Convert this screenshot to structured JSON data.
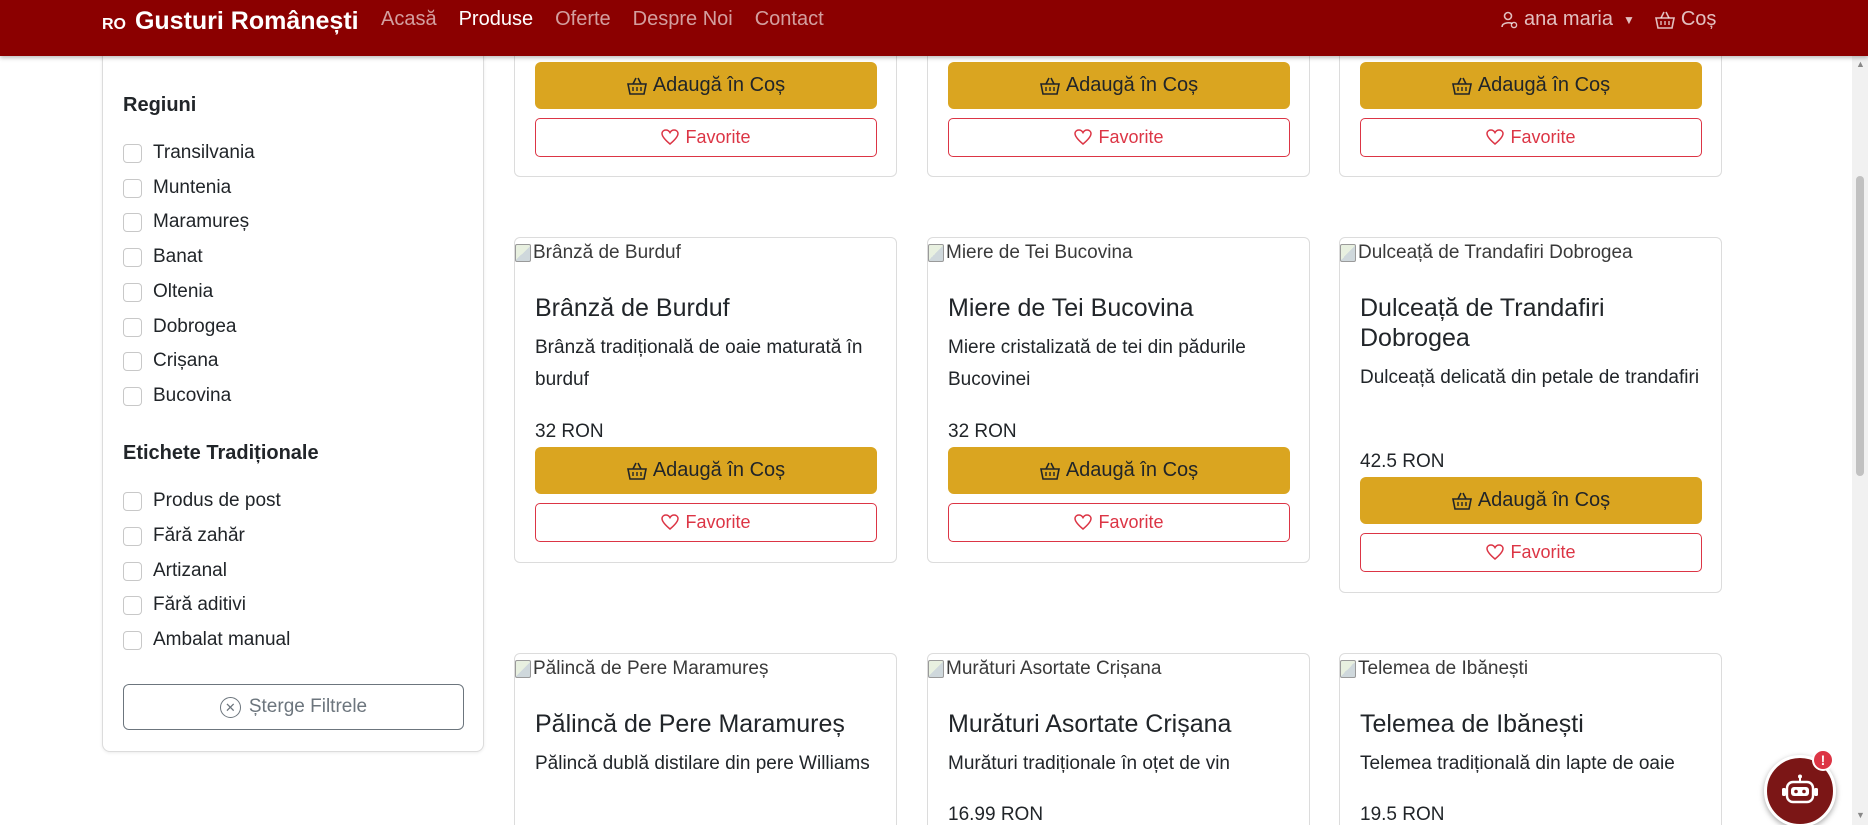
{
  "navbar": {
    "brand_prefix": "RO",
    "brand_name": "Gusturi Românești",
    "links": [
      {
        "label": "Acasă",
        "active": false
      },
      {
        "label": "Produse",
        "active": true
      },
      {
        "label": "Oferte",
        "active": false
      },
      {
        "label": "Despre Noi",
        "active": false
      },
      {
        "label": "Contact",
        "active": false
      }
    ],
    "user_name": "ana maria",
    "cart_label": "Coș",
    "background_color": "#8b0000"
  },
  "sidebar": {
    "regions_heading": "Regiuni",
    "regions": [
      "Transilvania",
      "Muntenia",
      "Maramureș",
      "Banat",
      "Oltenia",
      "Dobrogea",
      "Crișana",
      "Bucovina"
    ],
    "tags_heading": "Etichete Tradiționale",
    "tags": [
      "Produs de post",
      "Fără zahăr",
      "Artizanal",
      "Fără aditivi",
      "Ambalat manual"
    ],
    "clear_button": "Șterge Filtrele"
  },
  "buttons": {
    "add_to_cart": "Adaugă în Coș",
    "favorite": "Favorite"
  },
  "products": [
    {
      "image_alt": "Brânză de Burduf",
      "title": "Brânză de Burduf",
      "description": "Brânză tradițională de oaie maturată în burduf",
      "price": "32 RON"
    },
    {
      "image_alt": "Miere de Tei Bucovina",
      "title": "Miere de Tei Bucovina",
      "description": "Miere cristalizată de tei din pădurile Bucovinei",
      "price": "32 RON"
    },
    {
      "image_alt": "Dulceață de Trandafiri Dobrogea",
      "title": "Dulceață de Trandafiri Dobrogea",
      "description": "Dulceață delicată din petale de trandafiri",
      "price": "42.5 RON"
    },
    {
      "image_alt": "Pălincă de Pere Maramureș",
      "title": "Pălincă de Pere Maramureș",
      "description": "Pălincă dublă distilare din pere Williams",
      "price": ""
    },
    {
      "image_alt": "Murături Asortate Crișana",
      "title": "Murături Asortate Crișana",
      "description": "Murături tradiționale în oțet de vin",
      "price": "16.99 RON"
    },
    {
      "image_alt": "Telemea de Ibănești",
      "title": "Telemea de Ibănești",
      "description": "Telemea tradițională din lapte de oaie",
      "price": "19.5 RON"
    }
  ],
  "chatbot": {
    "badge": "!"
  },
  "colors": {
    "accent_gold": "#daa520",
    "favorite_red": "#dc3545",
    "chatbot_bg": "#7b1616"
  }
}
